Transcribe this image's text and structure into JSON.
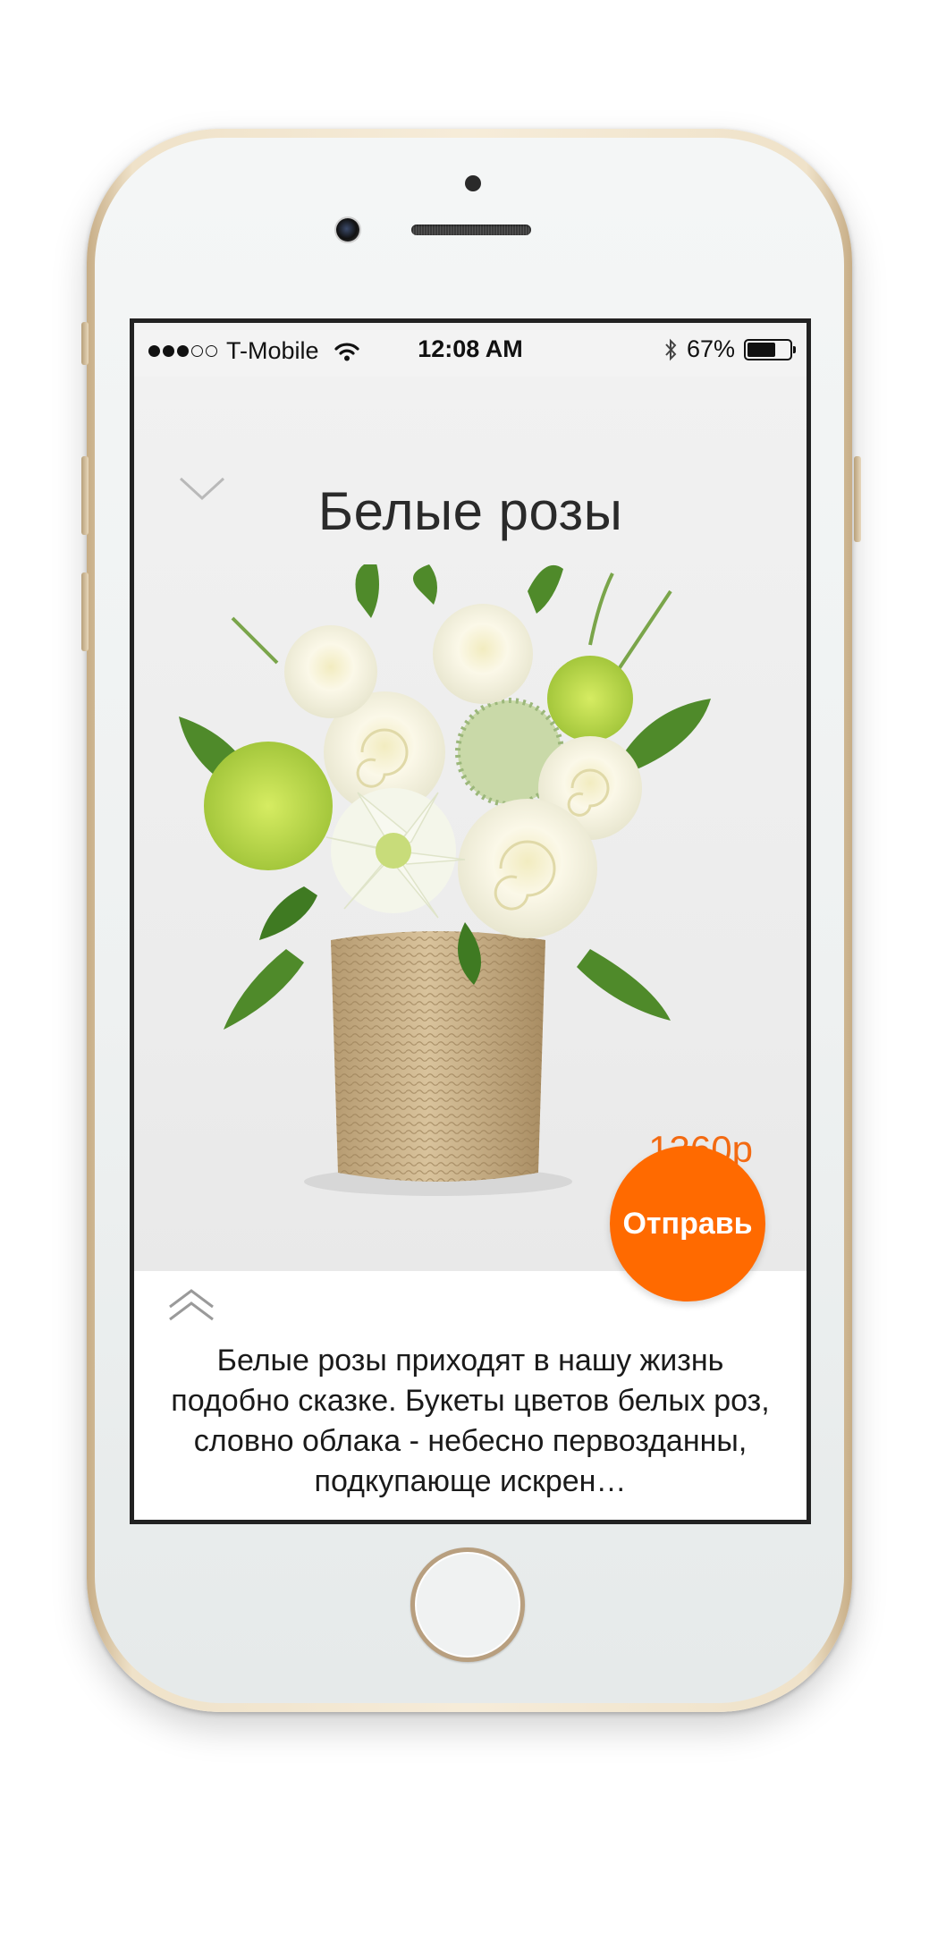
{
  "status_bar": {
    "signal_total": 5,
    "signal_filled": 3,
    "carrier": "T-Mobile",
    "wifi_icon": "wifi-icon",
    "time": "12:08 AM",
    "bluetooth_icon": "bluetooth-icon",
    "battery_label": "67%",
    "battery_level": 0.67
  },
  "product": {
    "title": "Белые розы",
    "price": "1360р",
    "send_label": "Отправь",
    "image_icon": "bouquet-image",
    "carousel": {
      "pages": 6,
      "active_index": 1
    }
  },
  "description": {
    "text": "Белые розы приходят в нашу жизнь подобно сказке. Букеты цветов белых роз, словно облака - небесно первозданны, подкупающе искрен…"
  },
  "colors": {
    "accent": "#ff6a00",
    "price": "#f36a12",
    "frame_gold": "#efe2c9"
  }
}
